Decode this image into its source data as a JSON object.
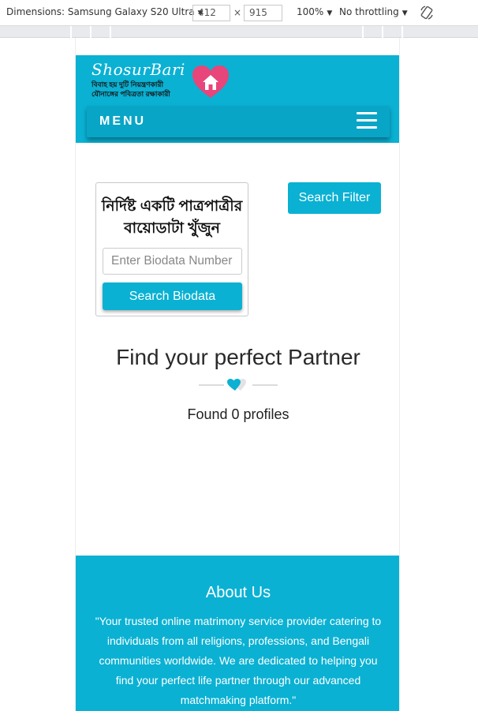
{
  "devtools": {
    "device_label": "Dimensions: Samsung Galaxy S20 Ultra",
    "width": "412",
    "height": "915",
    "zoom": "100%",
    "throttling": "No throttling",
    "times": "×"
  },
  "header": {
    "logo_title": "ShosurBari",
    "logo_line1": "বিবাহ হয় দুটি নিয়ন্ত্রণকারী",
    "logo_line2": "যৌনাঙ্গের পবিত্রতা রক্ষাকারী",
    "menu_label": "MENU"
  },
  "search": {
    "card_title_line1": "নির্দিষ্ট একটি পাত্রপাত্রীর",
    "card_title_line2": "বায়োডাটা খুঁজুন",
    "placeholder": "Enter Biodata Number",
    "search_button": "Search Biodata",
    "filter_button": "Search Filter"
  },
  "results": {
    "title": "Find your perfect Partner",
    "found_text": "Found 0 profiles"
  },
  "footer": {
    "about_title": "About Us",
    "about_text": "\"Your trusted online matrimony service provider catering to individuals from all religions, professions, and Bengali communities worldwide. We are dedicated to helping you find your perfect life partner through our advanced matchmaking platform.\""
  },
  "colors": {
    "accent": "#0ab1d3",
    "heart_pink": "#e8457a"
  }
}
